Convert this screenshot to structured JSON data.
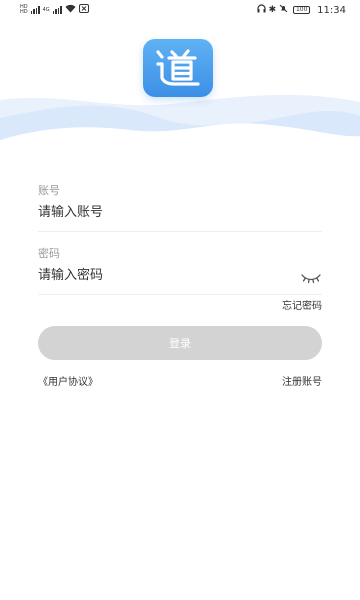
{
  "status_bar": {
    "sim1": "HD",
    "sim2": "HD",
    "network": "4G",
    "time": "11:34",
    "battery": "100",
    "icons": [
      "signal-icon",
      "wifi-icon",
      "nfc-icon",
      "headphones-icon",
      "bluetooth-icon",
      "mute-icon",
      "battery-icon"
    ]
  },
  "app": {
    "logo_char": "道",
    "logo_icon": "app-logo-icon",
    "accent_color": "#4a9ef0",
    "wave_color": "#e3eefb"
  },
  "form": {
    "account_label": "账号",
    "account_placeholder": "请输入账号",
    "password_label": "密码",
    "password_placeholder": "请输入密码",
    "eye_icon": "eye-closed-icon"
  },
  "links": {
    "forgot_password": "忘记密码",
    "user_agreement": "《用户协议》",
    "register": "注册账号"
  },
  "buttons": {
    "login": "登录",
    "login_disabled_color": "#d3d3d3"
  }
}
